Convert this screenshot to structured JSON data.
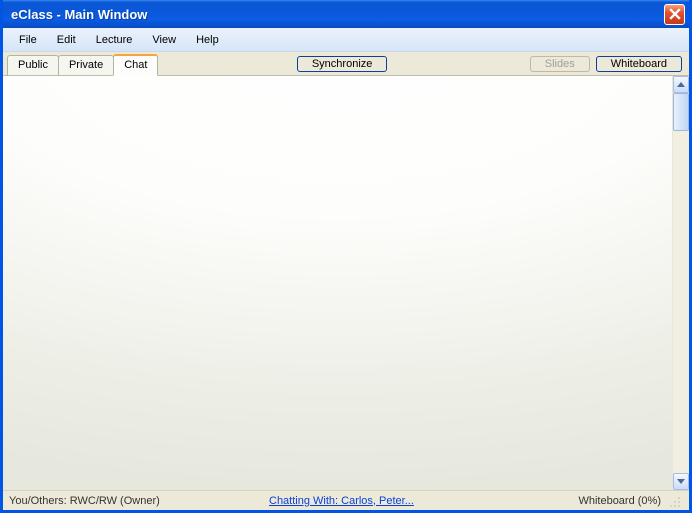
{
  "window": {
    "title": "eClass - Main Window"
  },
  "menubar": {
    "items": [
      {
        "label": "File"
      },
      {
        "label": "Edit"
      },
      {
        "label": "Lecture"
      },
      {
        "label": "View"
      },
      {
        "label": "Help"
      }
    ]
  },
  "toolbar": {
    "tabs": [
      {
        "label": "Public",
        "active": false
      },
      {
        "label": "Private",
        "active": false
      },
      {
        "label": "Chat",
        "active": true
      }
    ],
    "synchronize_label": "Synchronize",
    "slides_label": "Slides",
    "whiteboard_label": "Whiteboard"
  },
  "statusbar": {
    "left_text": "You/Others: RWC/RW  (Owner)",
    "center_link": "Chatting With: Carlos, Peter...",
    "right_text": "Whiteboard (0%)"
  }
}
